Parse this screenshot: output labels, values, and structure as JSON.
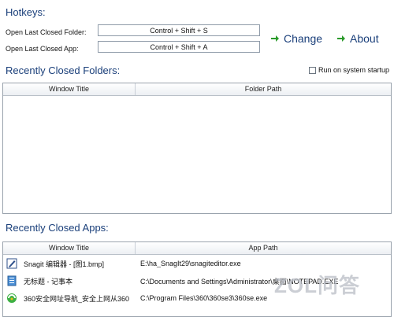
{
  "hotkeys": {
    "title": "Hotkeys:",
    "folder_label": "Open Last Closed Folder:",
    "folder_value": "Control + Shift + S",
    "app_label": "Open Last Closed App:",
    "app_value": "Control + Shift + A"
  },
  "actions": {
    "change_label": "Change",
    "about_label": "About",
    "arrow_icon": "green-arrow-right-icon",
    "accent_color": "#2a9a2a"
  },
  "folders": {
    "title": "Recently Closed Folders:",
    "startup_label": "Run on system startup",
    "startup_checked": false,
    "columns": [
      "Window Title",
      "Folder Path"
    ],
    "rows": []
  },
  "apps": {
    "title": "Recently Closed Apps:",
    "columns": [
      "Window Title",
      "App Path"
    ],
    "rows": [
      {
        "icon": "snagit-editor-icon",
        "title": "Snagit 编辑器 - [图1.bmp]",
        "path": "E:\\ha_SnagIt29\\snagiteditor.exe"
      },
      {
        "icon": "notepad-icon",
        "title": "无标题 - 记事本",
        "path": "C:\\Documents and Settings\\Administrator\\桌面\\NOTEPAD.EXE"
      },
      {
        "icon": "360-browser-icon",
        "title": "360安全网址导航_安全上网从360",
        "path": "C:\\Program Files\\360\\360se3\\360se.exe"
      }
    ]
  },
  "watermark": "ZOL问答",
  "colors": {
    "title": "#1a3f7a",
    "border": "#9aa3ad"
  }
}
